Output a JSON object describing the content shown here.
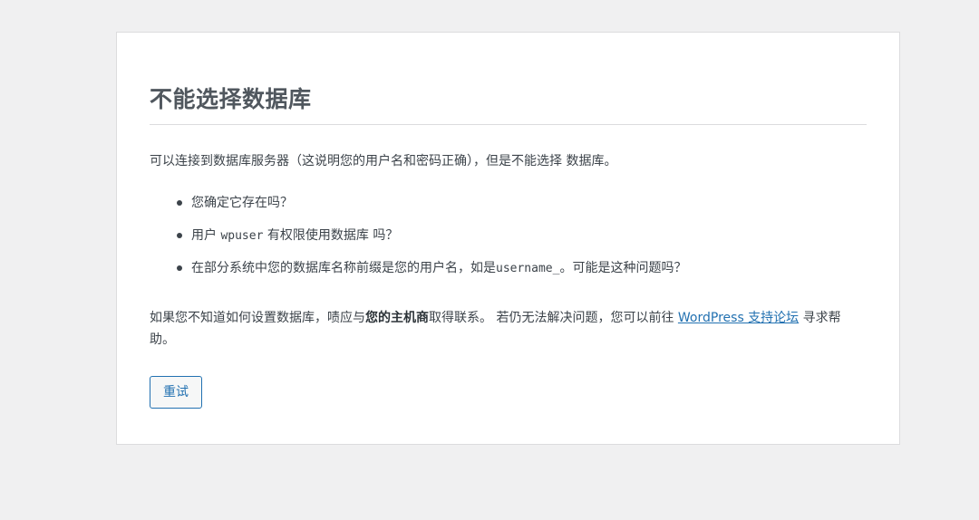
{
  "error": {
    "title": "不能选择数据库",
    "intro": "可以连接到数据库服务器（这说明您的用户名和密码正确），但是不能选择 数据库。",
    "bullets": {
      "item1": "您确定它存在吗？",
      "item2_prefix": "用户 ",
      "item2_user": "wpuser",
      "item2_suffix": " 有权限使用数据库 吗？",
      "item3_prefix": "在部分系统中您的数据库名称前缀是您的用户名，如是",
      "item3_code": "username_",
      "item3_suffix": "。可能是这种问题吗？"
    },
    "help": {
      "text1": "如果您不知道如何设置数据库，啧应与",
      "host_bold": "您的主机商",
      "text2": "取得联系。 若仍无法解决问题，您可以前往 ",
      "link": "WordPress 支持论坛",
      "text3": " 寻求帮助。"
    },
    "retry_label": "重试"
  }
}
